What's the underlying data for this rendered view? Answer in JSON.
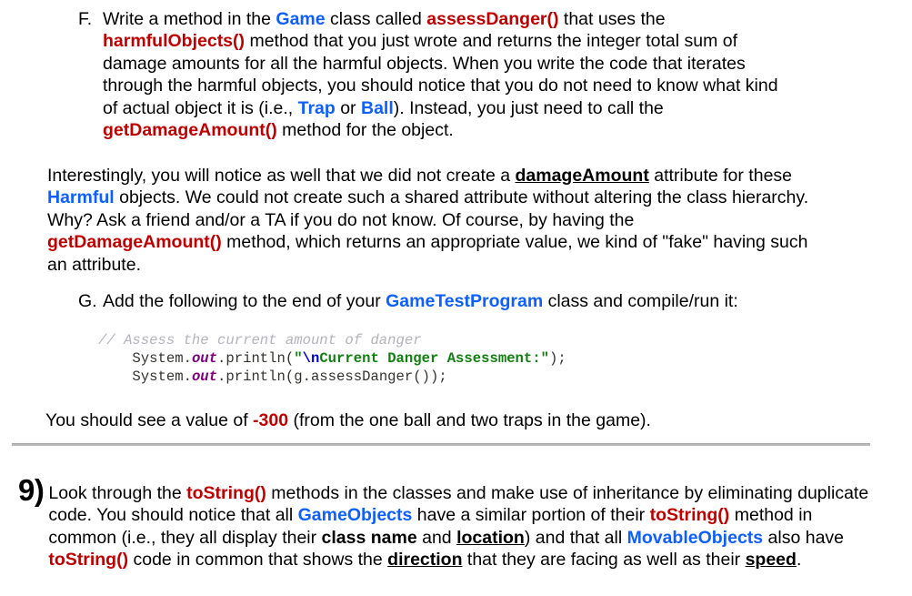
{
  "document": {
    "background_color": "#ffffff",
    "accent_colors": {
      "class_blue": "#0D5FFF",
      "method_red": "#C00000",
      "code_comment_gray": "#b3b3bb",
      "code_static_purple": "#800080",
      "code_string_green": "#108010",
      "code_escape_blue": "#0000e0",
      "divider_gray": "#b9b9b9"
    }
  },
  "item_f": {
    "marker": "F.",
    "line1_a": "Write a method in the ",
    "line1_class": "Game",
    "line1_b": " class called ",
    "line1_method": "assessDanger()",
    "line1_c": " that uses the ",
    "line2_method": "harmfulObjects()",
    "line2_a": " method that you just wrote and returns the integer total sum of damage amounts for all the harmful objects. When you write the code that iterates through the harmful objects, you should notice that you do not need to know what kind of actual object it is (i.e., ",
    "line5_class_trap": "Trap",
    "line5_or": " or ",
    "line5_class_ball": "Ball",
    "line5_b": "). Instead, you just need to call the ",
    "line6_method": "getDamageAmount()",
    "line6_a": " method for the object."
  },
  "paragraph_interestingly": {
    "part1": "Interestingly, you will notice as well that we did not create a ",
    "underlined1": "damageAmount",
    "part2": " attribute for these ",
    "class1": "Harmful",
    "part3": " objects. We could not create such a shared attribute without altering the class hierarchy. Why? Ask a friend and/or a TA if you do not know. Of course, by having the ",
    "method1": "getDamageAmount()",
    "part4": " method, which returns an appropriate value, we kind of \"fake\" having such an attribute."
  },
  "item_g": {
    "marker": "G.",
    "part1": "Add the following to the end of your ",
    "class1": "GameTestProgram",
    "part2": " class and compile/run it:"
  },
  "code_block": {
    "comment_line": "// Assess the current amount of danger",
    "line2_pre": "    System.",
    "line2_static": "out",
    "line2_mid": ".println(",
    "line2_quote_open": "\"",
    "line2_escape": "\\n",
    "line2_string": "Current Danger Assessment:",
    "line2_quote_close": "\"",
    "line2_post": ");",
    "line3_pre": "    System.",
    "line3_static": "out",
    "line3_post": ".println(g.assessDanger());"
  },
  "paragraph_value": {
    "part1": "You should see a value of ",
    "value": "-300",
    "part2": " (from the one ball and two traps in the game)."
  },
  "item_9": {
    "number": "9)",
    "part1": "Look through the ",
    "method1": "toString()",
    "part2": " methods in the classes and make use of inheritance by eliminating duplicate code. You should notice that all ",
    "class1": "GameObjects",
    "part3": " have a similar portion of their ",
    "method2": "toString()",
    "part4": " method in common (i.e., they all display their ",
    "bold1": "class name",
    "part5": " and ",
    "underlined1": "location",
    "part6": ") and that all ",
    "class2": "MovableObjects",
    "part7": " also have ",
    "method3": "toString()",
    "part8": " code in common that shows the ",
    "underlined2": "direction",
    "part9": " that they are facing as well as their ",
    "underlined3": "speed",
    "part10": "."
  }
}
